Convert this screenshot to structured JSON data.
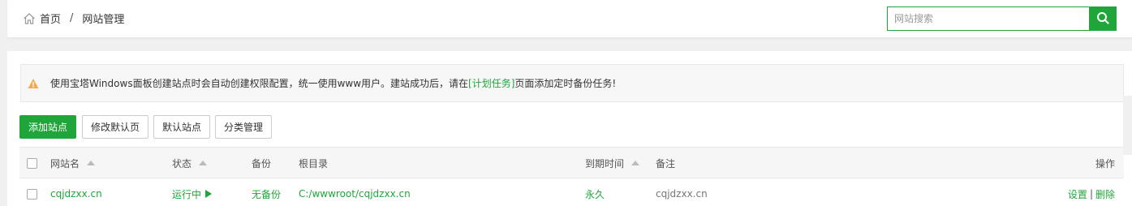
{
  "breadcrumb": {
    "home": "首页",
    "separator": "/",
    "current": "网站管理"
  },
  "search": {
    "placeholder": "网站搜索"
  },
  "notice": {
    "text_before": "使用宝塔Windows面板创建站点时会自动创建权限配置，统一使用www用户。建站成功后，请在",
    "link": "[计划任务]",
    "text_after": "页面添加定时备份任务!"
  },
  "toolbar": {
    "add_site": "添加站点",
    "edit_default_page": "修改默认页",
    "default_site": "默认站点",
    "category_manage": "分类管理"
  },
  "table": {
    "headers": {
      "site_name": "网站名",
      "status": "状态",
      "backup": "备份",
      "root_dir": "根目录",
      "expire": "到期时间",
      "remark": "备注",
      "actions": "操作"
    },
    "rows": [
      {
        "site_name": "cqjdzxx.cn",
        "status": "运行中",
        "backup": "无备份",
        "root_dir": "C:/wwwroot/cqjdzxx.cn",
        "expire": "永久",
        "remark": "cqjdzxx.cn",
        "action_settings": "设置",
        "action_sep": "|",
        "action_delete": "删除"
      }
    ]
  },
  "colors": {
    "accent": "#20a53a",
    "warning": "#f0ad4e"
  },
  "icons": {
    "home": "home-icon",
    "search": "search-icon",
    "warning": "warning-icon",
    "sort": "sort-up-icon",
    "running": "play-icon"
  }
}
